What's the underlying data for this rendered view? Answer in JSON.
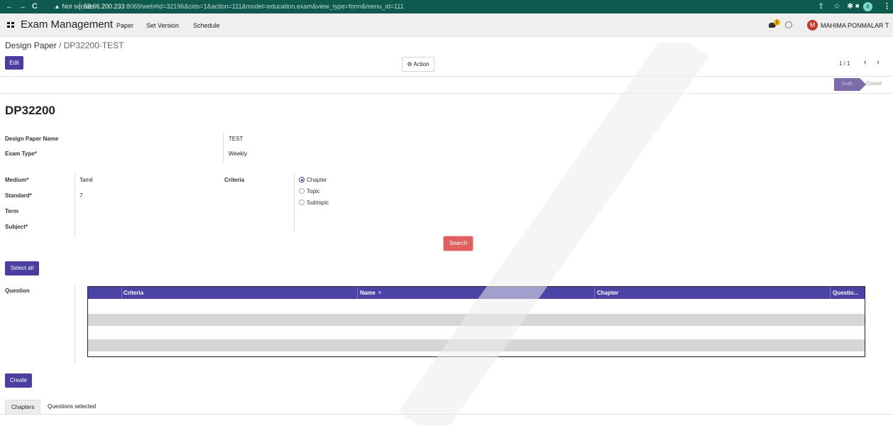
{
  "browser": {
    "not_secure": "Not secure",
    "url_host": "52.66.200.233",
    "url_rest": ":8069/web#id=32196&cids=1&action=111&model=education.exam&view_type=form&menu_id=111",
    "profile_initial": "A"
  },
  "navbar": {
    "brand": "Exam Management",
    "menu": [
      "Paper",
      "Set Version",
      "Schedule"
    ],
    "message_count": "1",
    "user_initial": "M",
    "user_name": "MAHIMA PONMALAR T"
  },
  "control": {
    "breadcrumb_parent": "Design Paper",
    "breadcrumb_sep": " / ",
    "breadcrumb_current": "DP32200-TEST",
    "edit_label": "Edit",
    "action_label": "Action",
    "pager": "1 / 1"
  },
  "statusbar": {
    "draft": "Draft",
    "closed": "Closed"
  },
  "form": {
    "record_name": "DP32200",
    "design_paper_name_label": "Design Paper Name",
    "design_paper_name": "TEST",
    "exam_type_label": "Exam Type*",
    "exam_type": "Weekly",
    "medium_label": "Medium*",
    "medium": "Tamil",
    "standard_label": "Standard*",
    "standard": "7",
    "term_label": "Term",
    "subject_label": "Subject*",
    "criteria_label": "Criteria",
    "criteria_options": [
      "Chapter",
      "Topic",
      "Subtopic"
    ],
    "criteria_selected": "Chapter",
    "search_label": "Search",
    "select_all_label": "Select all",
    "question_label": "Question",
    "create_label": "Create"
  },
  "table": {
    "columns": [
      "Criteria",
      "Name",
      "Chapter",
      "Questio..."
    ],
    "sort_indicator": "▼"
  },
  "tabs": [
    "Chapters",
    "Questions selected"
  ],
  "colors": {
    "browser_bar": "#0e5a4e",
    "primary": "#4a3fa0",
    "search": "#e06060",
    "table_header": "#4b42a6"
  },
  "icons": [
    "back-icon",
    "forward-icon",
    "reload-icon",
    "warning-icon",
    "share-icon",
    "star-icon",
    "extension-icon",
    "sidepanel-icon",
    "apps-icon",
    "chat-icon",
    "clock-icon",
    "gear-icon",
    "prev-icon",
    "next-icon",
    "kebab-icon"
  ]
}
